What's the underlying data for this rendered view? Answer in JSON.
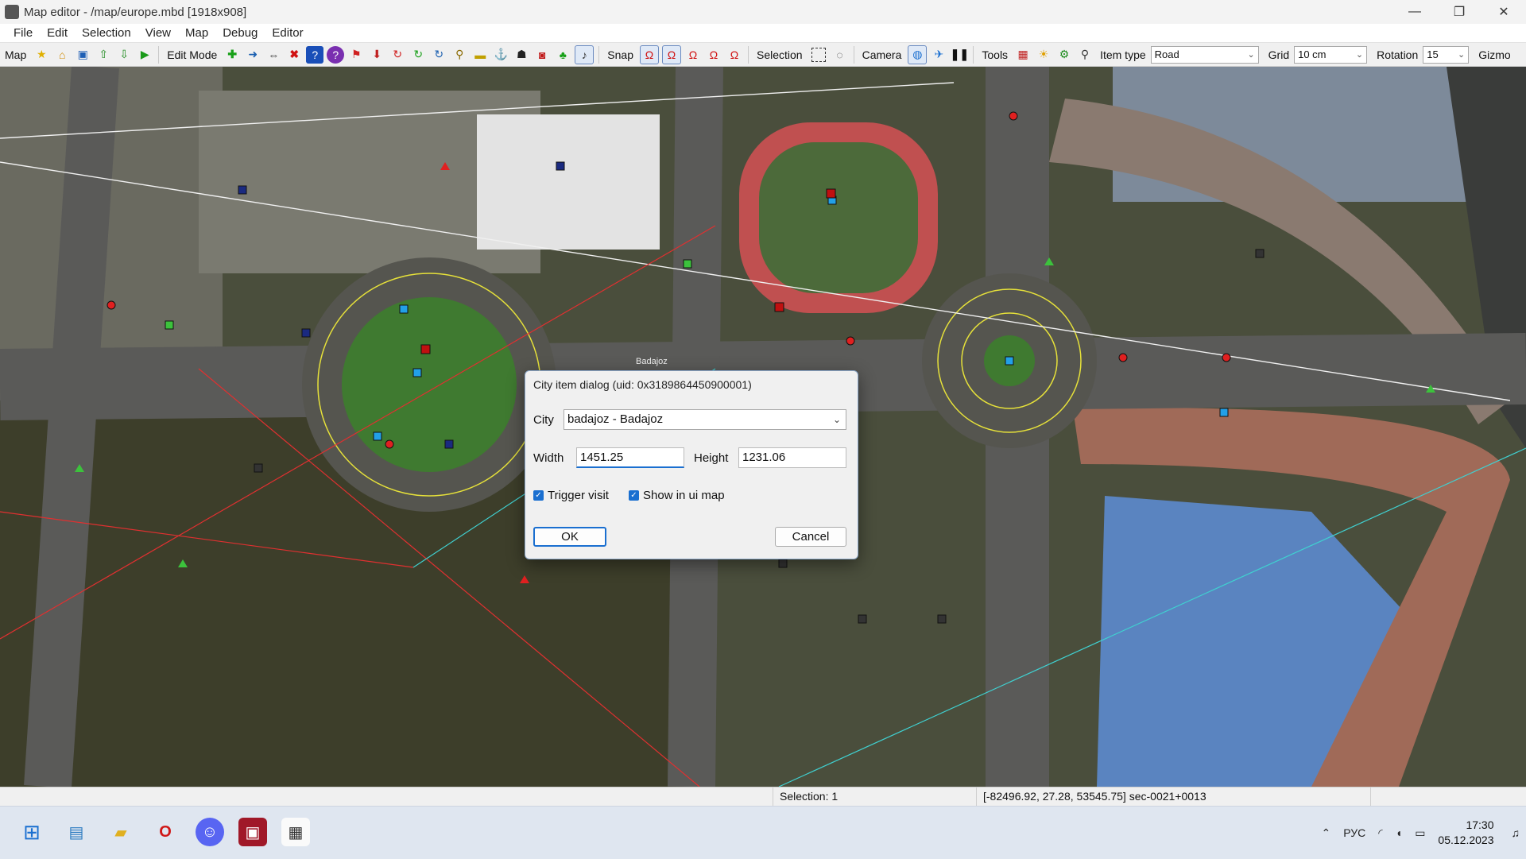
{
  "window": {
    "title": "Map editor - /map/europe.mbd [1918x908]",
    "controls": [
      "—",
      "❐",
      "✕"
    ]
  },
  "menu": [
    "File",
    "Edit",
    "Selection",
    "View",
    "Map",
    "Debug",
    "Editor"
  ],
  "toolbar": {
    "map_label": "Map",
    "edit_mode_label": "Edit Mode",
    "snap_label": "Snap",
    "selection_label": "Selection",
    "camera_label": "Camera",
    "tools_label": "Tools",
    "item_type_label": "Item type",
    "item_type_value": "Road",
    "grid_label": "Grid",
    "grid_value": "10 cm",
    "rotation_label": "Rotation",
    "rotation_value": "15",
    "gizmo_label": "Gizmo"
  },
  "icons": {
    "map_tools": [
      "star-icon",
      "house-icon",
      "save-icon",
      "upload-icon",
      "download-icon",
      "play-icon"
    ],
    "edit_tools": [
      "add-icon",
      "arrow-right-icon",
      "move-icon",
      "delete-icon",
      "help-icon",
      "question-icon",
      "flag-icon",
      "marker-icon",
      "rotate-icon",
      "refresh-icon",
      "redo-icon",
      "pin-icon",
      "sign-icon",
      "anchor-icon",
      "people-icon",
      "car-icon",
      "tree-icon",
      "sound-icon"
    ],
    "snap_tools": [
      "snap-1-icon",
      "snap-2-icon",
      "snap-3-icon",
      "snap-4-icon",
      "snap-5-icon"
    ],
    "selection_tools": [
      "rect-select-icon",
      "lasso-icon"
    ],
    "camera_tools": [
      "globe-icon",
      "bird-icon",
      "pause-icon"
    ],
    "misc_tools": [
      "palette-icon",
      "sun-icon",
      "gear-icon",
      "search-icon"
    ]
  },
  "map": {
    "city_label": "Badajoz"
  },
  "dialog": {
    "title": "City item dialog (uid: 0x3189864450900001)",
    "city_label": "City",
    "city_value": "badajoz - Badajoz",
    "width_label": "Width",
    "width_value": "1451.25",
    "height_label": "Height",
    "height_value": "1231.06",
    "trigger_visit_label": "Trigger visit",
    "trigger_visit_checked": true,
    "show_ui_map_label": "Show in ui map",
    "show_ui_map_checked": true,
    "ok_label": "OK",
    "cancel_label": "Cancel"
  },
  "status": {
    "selection": "Selection: 1",
    "coords": "[-82496.92, 27.28, 53545.75] sec-0021+0013"
  },
  "taskbar": {
    "apps": [
      "start-icon",
      "control-panel-icon",
      "folder-icon",
      "opera-icon",
      "discord-icon",
      "transport-app-icon",
      "map-editor-icon"
    ],
    "lang": "РУС",
    "time": "17:30",
    "date": "05.12.2023"
  },
  "colors": {
    "accent": "#1a6fd0",
    "road_lanes": "#e6e13a",
    "marker_red": "#e02020",
    "marker_blue": "#22a0e8",
    "marker_green": "#3cc23c"
  }
}
